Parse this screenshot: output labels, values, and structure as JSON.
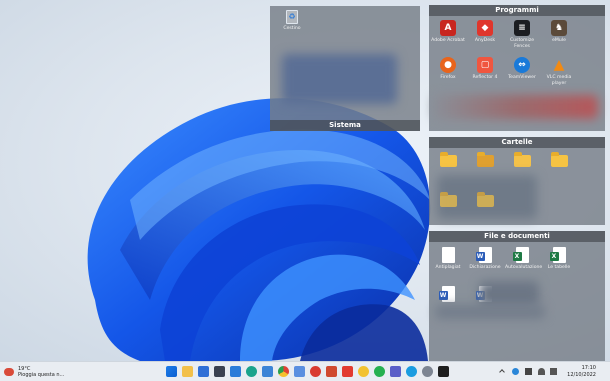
{
  "fences": {
    "sistema": {
      "title": "Sistema",
      "items": [
        {
          "label": "Cestino",
          "icon": "recycle-bin-icon"
        }
      ]
    },
    "programmi": {
      "title": "Programmi",
      "items": [
        {
          "label": "Adobe Acrobat",
          "icon": "adobe-acrobat-icon",
          "color": "#c8261f",
          "glyph": "A"
        },
        {
          "label": "AnyDesk",
          "icon": "anydesk-icon",
          "color": "#e0362c",
          "glyph": "◆"
        },
        {
          "label": "Customize Fences",
          "icon": "fences-icon",
          "color": "#1b1d21",
          "glyph": "≡"
        },
        {
          "label": "eMule",
          "icon": "emule-icon",
          "color": "#5b4a3a",
          "glyph": "♞"
        },
        {
          "label": "Firefox",
          "icon": "firefox-icon",
          "color": "#e8641c",
          "glyph": "●"
        },
        {
          "label": "Reflector 4",
          "icon": "reflector-icon",
          "color": "#f0563f",
          "glyph": "▢"
        },
        {
          "label": "TeamViewer",
          "icon": "teamviewer-icon",
          "color": "#1a7ad9",
          "glyph": "⇔"
        },
        {
          "label": "VLC media player",
          "icon": "vlc-icon",
          "color": "#f28a12",
          "glyph": "▲"
        }
      ]
    },
    "cartelle": {
      "title": "Cartelle"
    },
    "file": {
      "title": "File e documenti",
      "items": [
        {
          "label": "Antiplagiat",
          "type": "plain"
        },
        {
          "label": "Dichiarazione",
          "type": "word"
        },
        {
          "label": "Autovalutazione",
          "type": "excel"
        },
        {
          "label": "Le tabelle",
          "type": "excel"
        }
      ]
    }
  },
  "taskbar": {
    "weather_temp": "19°C",
    "weather_desc": "Pioggia questa n...",
    "time": "17:10",
    "date": "12/10/2022",
    "apps": [
      "start-icon",
      "search-icon",
      "file-explorer-icon",
      "store-icon",
      "settings-icon",
      "edge-icon",
      "mail-icon",
      "chrome-icon",
      "photos-icon",
      "media-icon",
      "office-icon",
      "anydesk-icon",
      "emoji-icon",
      "whatsapp-icon",
      "teams-icon",
      "skype-icon",
      "gear-icon",
      "terminal-icon"
    ]
  }
}
